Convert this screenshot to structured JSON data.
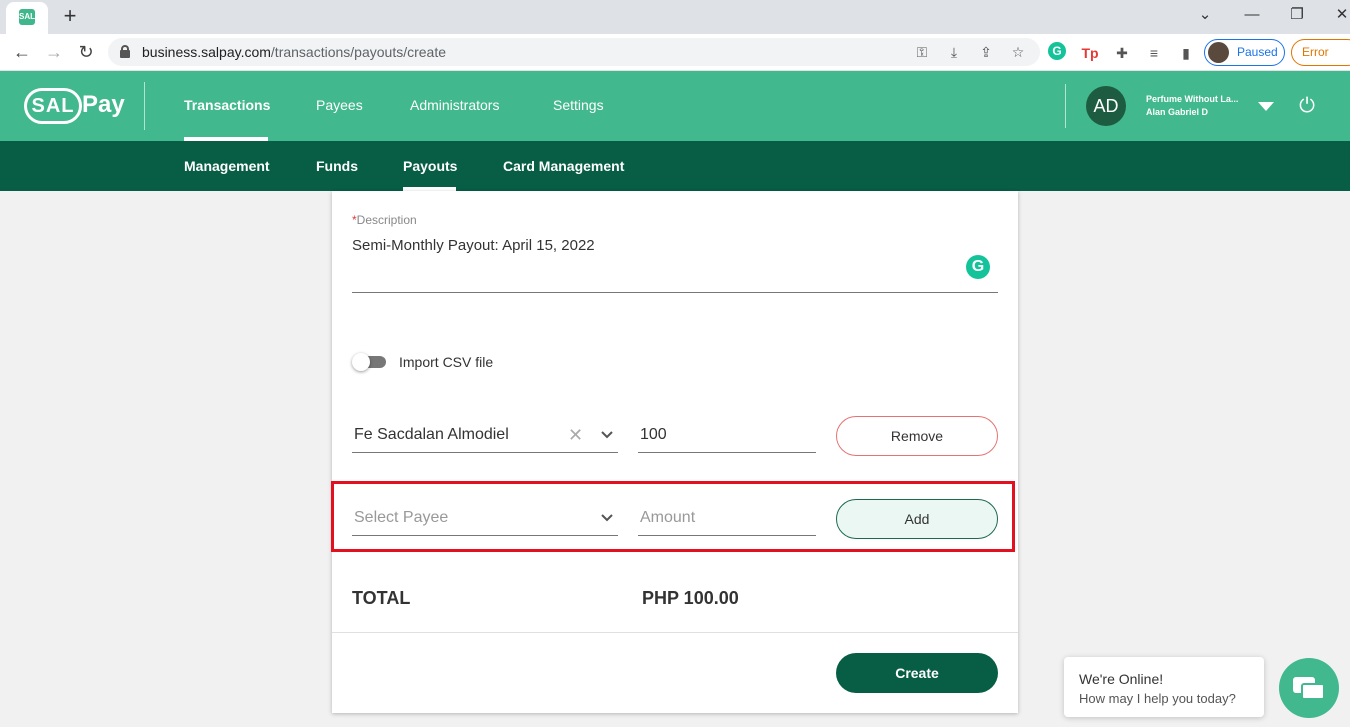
{
  "browser": {
    "new_tab": "+",
    "url_host": "business.salpay.com",
    "url_path": "/transactions/payouts/create",
    "profile_status": "Paused",
    "error_label": "Error",
    "favicon_text": "SAL"
  },
  "app": {
    "logo_sal": "SAL",
    "logo_pay": "Pay",
    "nav": [
      "Transactions",
      "Payees",
      "Administrators",
      "Settings"
    ],
    "active_nav": "Transactions",
    "user_initials": "AD",
    "user_company": "Perfume Without La...",
    "user_name": "Alan Gabriel D",
    "subnav": [
      "Management",
      "Funds",
      "Payouts",
      "Card Management"
    ],
    "active_subnav": "Payouts",
    "brand_color": "#41b88d",
    "dark_color": "#075e44"
  },
  "form": {
    "description_required_mark": "*",
    "description_label": "Description",
    "description_value": "Semi-Monthly Payout: April 15, 2022",
    "import_csv_label": "Import CSV file",
    "import_csv_enabled": false,
    "payees": [
      {
        "payee": "Fe Sacdalan Almodiel",
        "amount": "100",
        "action": "Remove"
      }
    ],
    "new_payee_placeholder": "Select Payee",
    "new_amount_placeholder": "Amount",
    "add_label": "Add",
    "total_label": "TOTAL",
    "total_value": "PHP 100.00",
    "create_label": "Create"
  },
  "chat": {
    "title": "We're Online!",
    "subtitle": "How may I help you today?"
  }
}
